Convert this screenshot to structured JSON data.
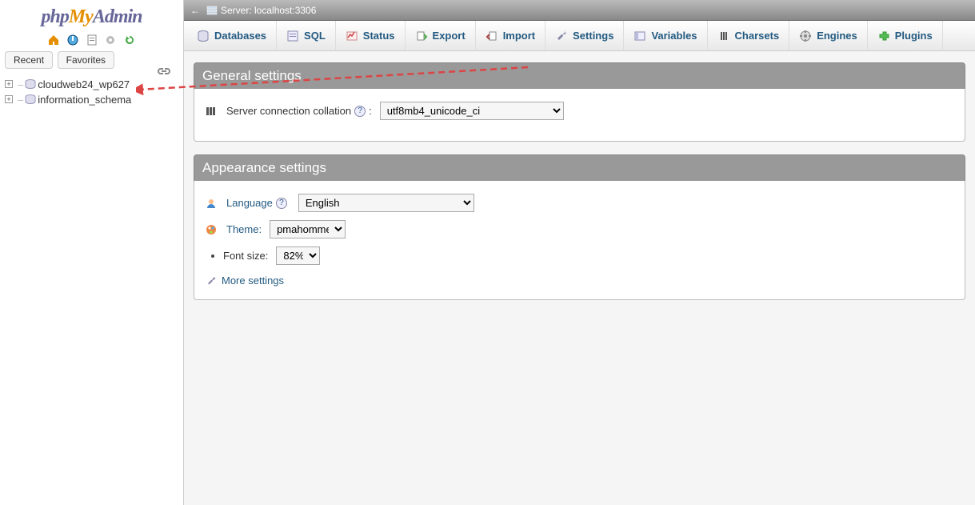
{
  "server_label": "Server: localhost:3306",
  "sidebar": {
    "tabs": {
      "recent": "Recent",
      "favorites": "Favorites"
    },
    "dbs": [
      "cloudweb24_wp627",
      "information_schema"
    ]
  },
  "menu": {
    "databases": "Databases",
    "sql": "SQL",
    "status": "Status",
    "export": "Export",
    "import": "Import",
    "settings": "Settings",
    "variables": "Variables",
    "charsets": "Charsets",
    "engines": "Engines",
    "plugins": "Plugins"
  },
  "general": {
    "header": "General settings",
    "collation_label": "Server connection collation",
    "collation_value": "utf8mb4_unicode_ci"
  },
  "appearance": {
    "header": "Appearance settings",
    "language_label": "Language",
    "language_value": "English",
    "theme_label": "Theme:",
    "theme_value": "pmahomme",
    "font_label": "Font size:",
    "font_value": "82%",
    "more_settings": "More settings"
  }
}
